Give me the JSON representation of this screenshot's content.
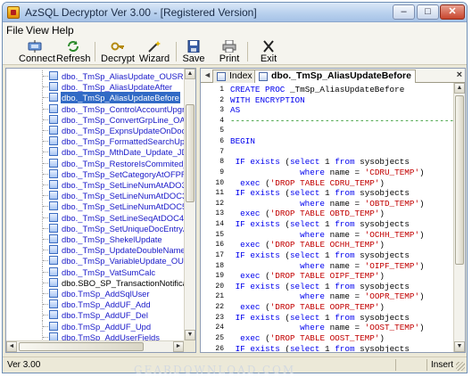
{
  "window": {
    "title": "AzSQL Decryptor Ver 3.00 - [Registered Version]"
  },
  "menu": [
    {
      "label": "File",
      "name": "menu-file"
    },
    {
      "label": "View",
      "name": "menu-view"
    },
    {
      "label": "Help",
      "name": "menu-help"
    }
  ],
  "toolbar": {
    "connect": "Connect",
    "refresh": "Refresh",
    "decrypt": "Decrypt",
    "wizard": "Wizard",
    "save": "Save",
    "print": "Print",
    "exit": "Exit"
  },
  "tree": {
    "items": [
      {
        "label": "dbo._TmSp_AliasUpdate_OUSR"
      },
      {
        "label": "dbo._TmSp_AliasUpdateAfter"
      },
      {
        "label": "dbo._TmSp_AliasUpdateBefore",
        "selected": true
      },
      {
        "label": "dbo._TmSp_ControlAccountUpgrade_O"
      },
      {
        "label": "dbo._TmSp_ConvertGrpLine_OACT"
      },
      {
        "label": "dbo._TmSp_ExpnsUpdateOnDocs"
      },
      {
        "label": "dbo._TmSp_FormattedSearchUpdate"
      },
      {
        "label": "dbo._TmSp_MthDate_Update_JDT1"
      },
      {
        "label": "dbo._TmSp_RestoreIsCommited_OIBT"
      },
      {
        "label": "dbo._TmSp_SetCategoryAtOFPR"
      },
      {
        "label": "dbo._TmSp_SetLineNumAtADO3"
      },
      {
        "label": "dbo._TmSp_SetLineNumAtDOC3"
      },
      {
        "label": "dbo._TmSp_SetLineNumAtDOC5"
      },
      {
        "label": "dbo._TmSp_SetLineSeqAtDOC4"
      },
      {
        "label": "dbo._TmSp_SetUniqueDocEntryAtOCRI"
      },
      {
        "label": "dbo._TmSp_ShekelUpdate"
      },
      {
        "label": "dbo._TmSp_UpdateDoubleName"
      },
      {
        "label": "dbo._TmSp_VariableUpdate_OUQR"
      },
      {
        "label": "dbo._TmSp_VatSumCalc"
      },
      {
        "label": "dbo.SBO_SP_TransactionNotification",
        "black": true
      },
      {
        "label": "dbo.TmSp_AddSqlUser"
      },
      {
        "label": "dbo.TmSp_AddUF_Add"
      },
      {
        "label": "dbo.TmSp_AddUF_Del"
      },
      {
        "label": "dbo.TmSp_AddUF_Upd"
      },
      {
        "label": "dbo.TmSp_AddUserFields"
      }
    ]
  },
  "tabs": {
    "nav": "◄",
    "index": "Index",
    "active": "dbo._TmSp_AliasUpdateBefore",
    "close": "×"
  },
  "code": {
    "lines": [
      {
        "n": "1",
        "parts": [
          [
            "kw",
            "CREATE PROC "
          ],
          [
            "pl",
            "_TmSp_AliasUpdateBefore"
          ]
        ]
      },
      {
        "n": "2",
        "parts": [
          [
            "kw",
            "WITH ENCRYPTION"
          ]
        ]
      },
      {
        "n": "3",
        "parts": [
          [
            "kw",
            "AS"
          ]
        ]
      },
      {
        "n": "4",
        "parts": [
          [
            "cm",
            "-------------------------------------------------"
          ]
        ]
      },
      {
        "n": "5",
        "parts": []
      },
      {
        "n": "6",
        "parts": [
          [
            "kw",
            "BEGIN"
          ]
        ]
      },
      {
        "n": "7",
        "parts": []
      },
      {
        "n": "8",
        "parts": [
          [
            "kw",
            " IF exists "
          ],
          [
            "pl",
            "("
          ],
          [
            "kw",
            "select "
          ],
          [
            "pl",
            "1 "
          ],
          [
            "kw",
            "from "
          ],
          [
            "pl",
            "sysobjects"
          ]
        ]
      },
      {
        "n": "9",
        "parts": [
          [
            "kw",
            "              where "
          ],
          [
            "pl",
            "name = "
          ],
          [
            "str",
            "'CDRU_TEMP'"
          ],
          [
            "pl",
            ")"
          ]
        ]
      },
      {
        "n": "10",
        "parts": [
          [
            "kw",
            "  exec "
          ],
          [
            "pl",
            "("
          ],
          [
            "str",
            "'DROP TABLE CDRU_TEMP'"
          ],
          [
            "pl",
            ")"
          ]
        ]
      },
      {
        "n": "11",
        "parts": [
          [
            "kw",
            " IF exists "
          ],
          [
            "pl",
            "("
          ],
          [
            "kw",
            "select "
          ],
          [
            "pl",
            "1 "
          ],
          [
            "kw",
            "from "
          ],
          [
            "pl",
            "sysobjects"
          ]
        ]
      },
      {
        "n": "12",
        "parts": [
          [
            "kw",
            "              where "
          ],
          [
            "pl",
            "name = "
          ],
          [
            "str",
            "'OBTD_TEMP'"
          ],
          [
            "pl",
            ")"
          ]
        ]
      },
      {
        "n": "13",
        "parts": [
          [
            "kw",
            "  exec "
          ],
          [
            "pl",
            "("
          ],
          [
            "str",
            "'DROP TABLE OBTD_TEMP'"
          ],
          [
            "pl",
            ")"
          ]
        ]
      },
      {
        "n": "14",
        "parts": [
          [
            "kw",
            " IF exists "
          ],
          [
            "pl",
            "("
          ],
          [
            "kw",
            "select "
          ],
          [
            "pl",
            "1 "
          ],
          [
            "kw",
            "from "
          ],
          [
            "pl",
            "sysobjects"
          ]
        ]
      },
      {
        "n": "15",
        "parts": [
          [
            "kw",
            "              where "
          ],
          [
            "pl",
            "name = "
          ],
          [
            "str",
            "'OCHH_TEMP'"
          ],
          [
            "pl",
            ")"
          ]
        ]
      },
      {
        "n": "16",
        "parts": [
          [
            "kw",
            "  exec "
          ],
          [
            "pl",
            "("
          ],
          [
            "str",
            "'DROP TABLE OCHH_TEMP'"
          ],
          [
            "pl",
            ")"
          ]
        ]
      },
      {
        "n": "17",
        "parts": [
          [
            "kw",
            " IF exists "
          ],
          [
            "pl",
            "("
          ],
          [
            "kw",
            "select "
          ],
          [
            "pl",
            "1 "
          ],
          [
            "kw",
            "from "
          ],
          [
            "pl",
            "sysobjects"
          ]
        ]
      },
      {
        "n": "18",
        "parts": [
          [
            "kw",
            "              where "
          ],
          [
            "pl",
            "name = "
          ],
          [
            "str",
            "'OIPF_TEMP'"
          ],
          [
            "pl",
            ")"
          ]
        ]
      },
      {
        "n": "19",
        "parts": [
          [
            "kw",
            "  exec "
          ],
          [
            "pl",
            "("
          ],
          [
            "str",
            "'DROP TABLE OIPF_TEMP'"
          ],
          [
            "pl",
            ")"
          ]
        ]
      },
      {
        "n": "20",
        "parts": [
          [
            "kw",
            " IF exists "
          ],
          [
            "pl",
            "("
          ],
          [
            "kw",
            "select "
          ],
          [
            "pl",
            "1 "
          ],
          [
            "kw",
            "from "
          ],
          [
            "pl",
            "sysobjects"
          ]
        ]
      },
      {
        "n": "21",
        "parts": [
          [
            "kw",
            "              where "
          ],
          [
            "pl",
            "name = "
          ],
          [
            "str",
            "'OOPR_TEMP'"
          ],
          [
            "pl",
            ")"
          ]
        ]
      },
      {
        "n": "22",
        "parts": [
          [
            "kw",
            "  exec "
          ],
          [
            "pl",
            "("
          ],
          [
            "str",
            "'DROP TABLE OOPR_TEMP'"
          ],
          [
            "pl",
            ")"
          ]
        ]
      },
      {
        "n": "23",
        "parts": [
          [
            "kw",
            " IF exists "
          ],
          [
            "pl",
            "("
          ],
          [
            "kw",
            "select "
          ],
          [
            "pl",
            "1 "
          ],
          [
            "kw",
            "from "
          ],
          [
            "pl",
            "sysobjects"
          ]
        ]
      },
      {
        "n": "24",
        "parts": [
          [
            "kw",
            "              where "
          ],
          [
            "pl",
            "name = "
          ],
          [
            "str",
            "'OOST_TEMP'"
          ],
          [
            "pl",
            ")"
          ]
        ]
      },
      {
        "n": "25",
        "parts": [
          [
            "kw",
            "  exec "
          ],
          [
            "pl",
            "("
          ],
          [
            "str",
            "'DROP TABLE OOST_TEMP'"
          ],
          [
            "pl",
            ")"
          ]
        ]
      },
      {
        "n": "26",
        "parts": [
          [
            "kw",
            " IF exists "
          ],
          [
            "pl",
            "("
          ],
          [
            "kw",
            "select "
          ],
          [
            "pl",
            "1 "
          ],
          [
            "kw",
            "from "
          ],
          [
            "pl",
            "sysobjects"
          ]
        ]
      }
    ]
  },
  "status": {
    "version": "Ver 3.00",
    "mode": "Insert"
  },
  "watermark": "GearDownload.com",
  "colors": {
    "keyword": "#0000ee",
    "string": "#c20000",
    "comment": "#008000",
    "selection": "#316ac5",
    "tree_text": "#1818c8"
  }
}
